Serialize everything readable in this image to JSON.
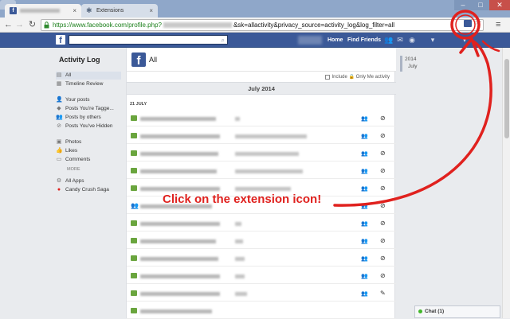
{
  "browser": {
    "tabs": [
      {
        "title": "",
        "icon": "facebook-favicon",
        "active": true
      },
      {
        "title": "Extensions",
        "icon": "puzzle-icon",
        "active": false
      }
    ],
    "url_prefix": "https://www.facebook.com/profile.php?",
    "url_suffix": "&sk=allactivity&privacy_source=activity_log&log_filter=all",
    "close_glyph": "×"
  },
  "fb": {
    "logo": "f",
    "home": "Home",
    "find_friends": "Find Friends"
  },
  "left": {
    "title": "Activity Log",
    "items": [
      {
        "label": "All",
        "icon": "list-icon"
      },
      {
        "label": "Timeline Review",
        "icon": "document-icon"
      },
      {
        "label": "Your posts",
        "icon": "person-icon"
      },
      {
        "label": "Posts You're Tagge...",
        "icon": "tag-icon"
      },
      {
        "label": "Posts by others",
        "icon": "people-icon"
      },
      {
        "label": "Posts You've Hidden",
        "icon": "hidden-icon"
      },
      {
        "label": "Photos",
        "icon": "photo-icon"
      },
      {
        "label": "Likes",
        "icon": "like-icon"
      },
      {
        "label": "Comments",
        "icon": "comment-icon"
      },
      {
        "label": "All Apps",
        "icon": "apps-icon"
      },
      {
        "label": "Candy Crush Saga",
        "icon": "candy-crush-icon"
      }
    ],
    "more": "MORE"
  },
  "main": {
    "title": "All",
    "only_me": "Include 🔒 Only Me activity",
    "month": "July 2014",
    "day": "21 JULY"
  },
  "right": {
    "year": "2014",
    "month": "July"
  },
  "chat": {
    "label": "Chat (1)"
  },
  "annotation": {
    "text": "Click on the extension icon!",
    "color": "#e0211e"
  },
  "colors": {
    "facebook_blue": "#3b5998",
    "comment_green": "#6aa53e"
  }
}
